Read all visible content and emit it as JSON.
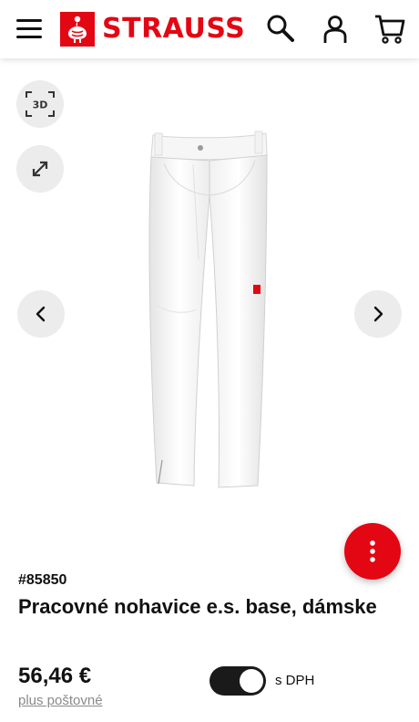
{
  "header": {
    "brand": "STRAUSS",
    "brand_color": "#e30613",
    "icons": [
      "menu-icon",
      "search-icon",
      "user-icon",
      "cart-icon"
    ]
  },
  "gallery": {
    "btn_3d_label": "3D",
    "image_description": "white women's work trousers"
  },
  "product": {
    "article_number": "#85850",
    "title": "Pracovné nohavice e.s. base, dámske",
    "price": "56,46 €",
    "shipping_link": "plus poštovné",
    "vat_toggle_label": "s DPH",
    "vat_toggle_on": true
  }
}
